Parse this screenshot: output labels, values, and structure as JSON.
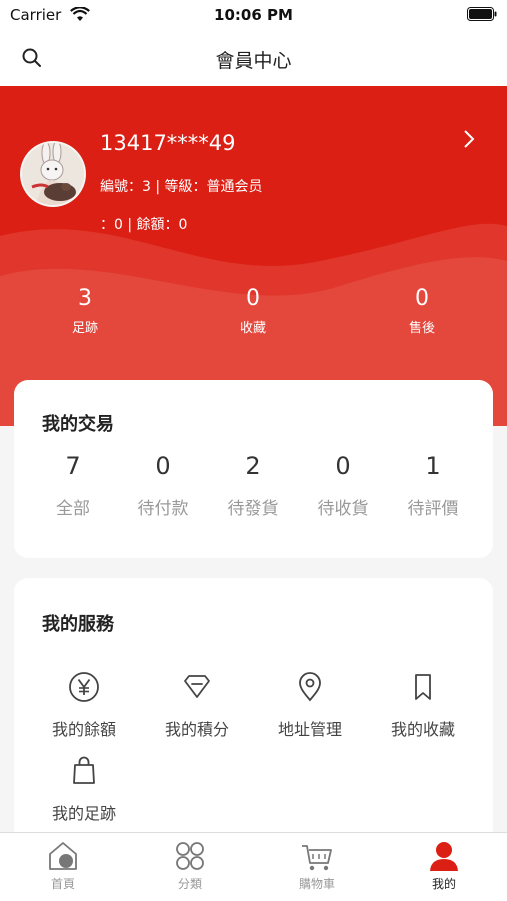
{
  "status_bar": {
    "carrier": "Carrier",
    "time": "10:06 PM"
  },
  "nav": {
    "title": "會員中心",
    "search_icon": "search-icon"
  },
  "profile": {
    "phone": "13417****49",
    "meta_line1": "編號：3 | 等級：普通会员",
    "meta_line2": "：0 | 餘額：0"
  },
  "stats": [
    {
      "value": "3",
      "label": "足跡"
    },
    {
      "value": "0",
      "label": "收藏"
    },
    {
      "value": "0",
      "label": "售後"
    }
  ],
  "trade": {
    "title": "我的交易",
    "items": [
      {
        "value": "7",
        "label": "全部"
      },
      {
        "value": "0",
        "label": "待付款"
      },
      {
        "value": "2",
        "label": "待發貨"
      },
      {
        "value": "0",
        "label": "待收貨"
      },
      {
        "value": "1",
        "label": "待評價"
      }
    ]
  },
  "services": {
    "title": "我的服務",
    "items": [
      {
        "label": "我的餘額",
        "icon": "yen-icon"
      },
      {
        "label": "我的積分",
        "icon": "diamond-icon"
      },
      {
        "label": "地址管理",
        "icon": "location-pin-icon"
      },
      {
        "label": "我的收藏",
        "icon": "bookmark-icon"
      },
      {
        "label": "我的足跡",
        "icon": "shopping-bag-icon"
      }
    ]
  },
  "tabs": [
    {
      "label": "首頁",
      "icon": "home-icon"
    },
    {
      "label": "分類",
      "icon": "grid-icon"
    },
    {
      "label": "購物車",
      "icon": "cart-icon"
    },
    {
      "label": "我的",
      "icon": "user-icon",
      "active": true
    }
  ],
  "colors": {
    "accent": "#db1f14",
    "background": "#f5f5f5",
    "card": "#ffffff"
  }
}
